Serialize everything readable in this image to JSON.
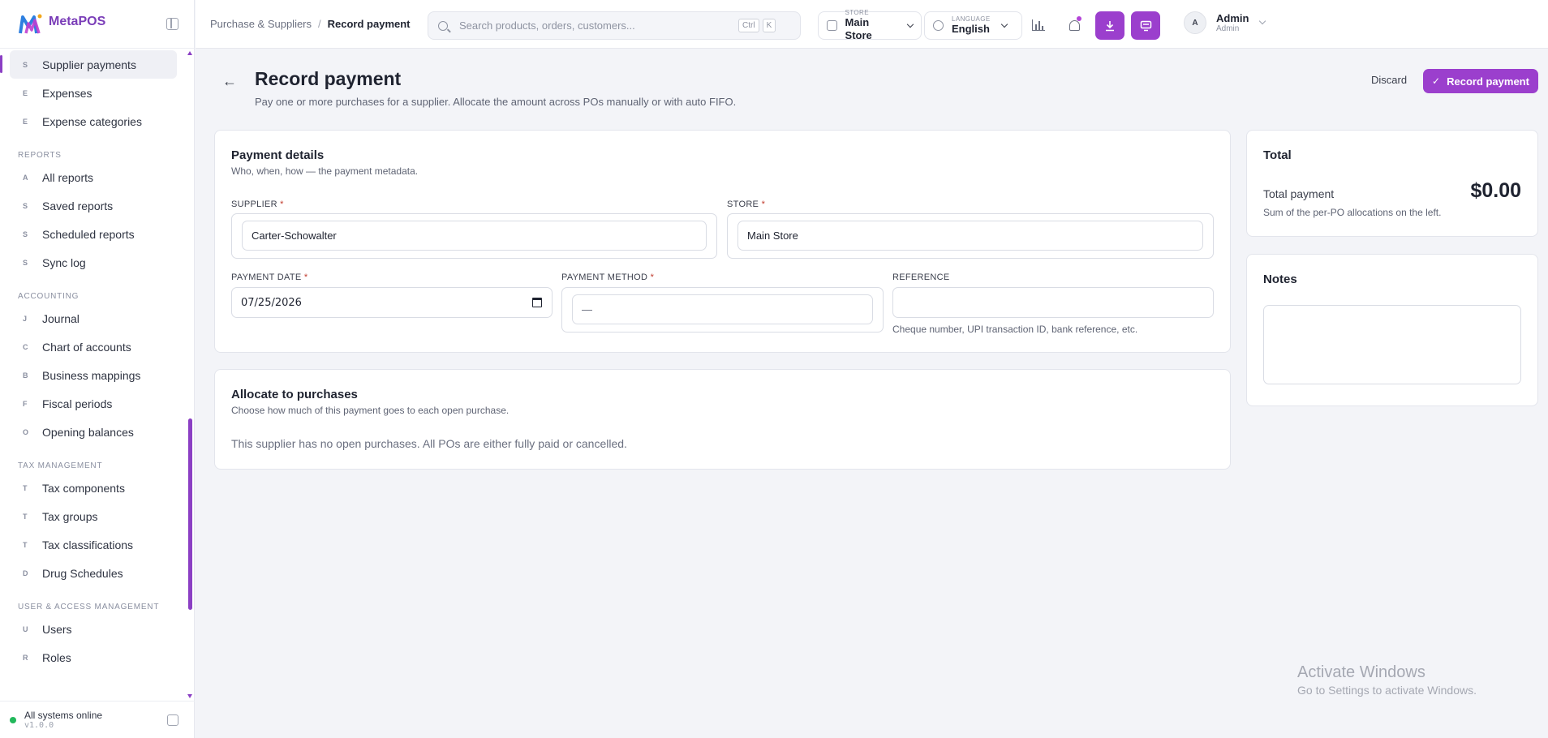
{
  "brand": {
    "name": "MetaPOS"
  },
  "sidebar": {
    "groups": [
      {
        "title": "",
        "items": [
          {
            "letter": "S",
            "label": "Supplier payments",
            "active": true
          },
          {
            "letter": "E",
            "label": "Expenses"
          },
          {
            "letter": "E",
            "label": "Expense categories"
          }
        ]
      },
      {
        "title": "REPORTS",
        "items": [
          {
            "letter": "A",
            "label": "All reports"
          },
          {
            "letter": "S",
            "label": "Saved reports"
          },
          {
            "letter": "S",
            "label": "Scheduled reports"
          },
          {
            "letter": "S",
            "label": "Sync log"
          }
        ]
      },
      {
        "title": "ACCOUNTING",
        "items": [
          {
            "letter": "J",
            "label": "Journal"
          },
          {
            "letter": "C",
            "label": "Chart of accounts"
          },
          {
            "letter": "B",
            "label": "Business mappings"
          },
          {
            "letter": "F",
            "label": "Fiscal periods"
          },
          {
            "letter": "O",
            "label": "Opening balances"
          }
        ]
      },
      {
        "title": "TAX MANAGEMENT",
        "items": [
          {
            "letter": "T",
            "label": "Tax components"
          },
          {
            "letter": "T",
            "label": "Tax groups"
          },
          {
            "letter": "T",
            "label": "Tax classifications"
          },
          {
            "letter": "D",
            "label": "Drug Schedules"
          }
        ]
      },
      {
        "title": "USER & ACCESS MANAGEMENT",
        "items": [
          {
            "letter": "U",
            "label": "Users"
          },
          {
            "letter": "R",
            "label": "Roles"
          }
        ]
      }
    ],
    "footer": {
      "status": "All systems online",
      "version": "v1.0.0"
    }
  },
  "topbar": {
    "breadcrumb": {
      "parent": "Purchase & Suppliers",
      "separator": "/",
      "current": "Record payment"
    },
    "search": {
      "placeholder": "Search products, orders, customers...",
      "kbd1": "Ctrl",
      "kbd2": "K"
    },
    "store": {
      "label": "STORE",
      "value": "Main Store"
    },
    "language": {
      "label": "LANGUAGE",
      "value": "English"
    },
    "user": {
      "initial": "A",
      "name": "Admin",
      "role": "Admin"
    }
  },
  "page": {
    "title": "Record payment",
    "subtitle": "Pay one or more purchases for a supplier. Allocate the amount across POs manually or with auto FIFO.",
    "discard_label": "Discard",
    "primary_label": "Record payment"
  },
  "payment_details": {
    "title": "Payment details",
    "subtitle": "Who, when, how — the payment metadata.",
    "supplier": {
      "label": "SUPPLIER",
      "value": "Carter-Schowalter"
    },
    "store": {
      "label": "STORE",
      "value": "Main Store"
    },
    "payment_date": {
      "label": "PAYMENT DATE",
      "value": "07/25/2026"
    },
    "payment_method": {
      "label": "PAYMENT METHOD",
      "value": "—"
    },
    "reference": {
      "label": "REFERENCE",
      "value": "",
      "hint": "Cheque number, UPI transaction ID, bank reference, etc."
    },
    "required_mark": "*"
  },
  "allocate": {
    "title": "Allocate to purchases",
    "subtitle": "Choose how much of this payment goes to each open purchase.",
    "empty": "This supplier has no open purchases. All POs are either fully paid or cancelled."
  },
  "total": {
    "title": "Total",
    "label": "Total payment",
    "amount": "$0.00",
    "hint": "Sum of the per-PO allocations on the left."
  },
  "notes": {
    "title": "Notes",
    "value": ""
  },
  "watermark": {
    "line1": "Activate Windows",
    "line2": "Go to Settings to activate Windows."
  },
  "colors": {
    "accent": "#9b3fcd",
    "status_ok": "#22b85b"
  }
}
